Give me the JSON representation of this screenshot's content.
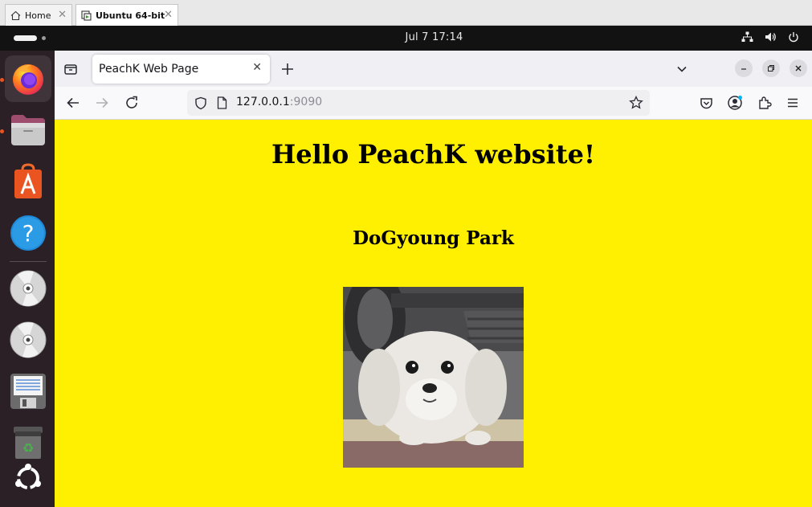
{
  "vm_tabs": [
    {
      "label": "Home"
    },
    {
      "label": "Ubuntu 64-bit"
    }
  ],
  "topbar": {
    "clock": "Jul 7  17:14"
  },
  "dock": {
    "items": [
      "firefox-icon",
      "files-icon",
      "app-center-icon",
      "help-icon",
      "disc-icon",
      "disc-icon",
      "text-editor-icon",
      "trash-icon",
      "ubuntu-logo-icon"
    ]
  },
  "browser": {
    "tab_title": "PeachK Web Page",
    "url_host": "127.0.0.1",
    "url_port": ":9090"
  },
  "page": {
    "heading": "Hello PeachK website!",
    "subheading": "DoGyoung Park",
    "background_color": "#ffef00"
  }
}
